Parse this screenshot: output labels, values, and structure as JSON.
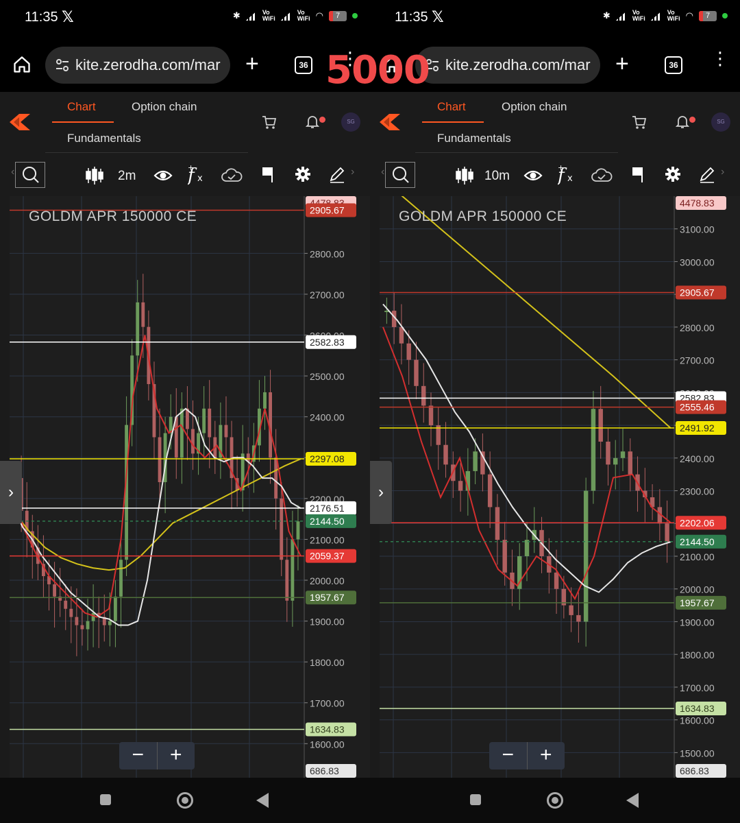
{
  "overlay_text": "5000",
  "screens": [
    {
      "status": {
        "time": "11:35",
        "vo_wifi": "Vo WiFi",
        "battery": "7"
      },
      "browser": {
        "url": "kite.zerodha.com/mar",
        "tab_count": "36"
      },
      "tabs": {
        "chart": "Chart",
        "option_chain": "Option chain",
        "fundamentals": "Fundamentals"
      },
      "avatar": "SG",
      "toolbar": {
        "interval": "2m"
      },
      "chart_data": {
        "type": "candlestick",
        "symbol": "GOLDM APR 150000 CE",
        "interval": "2m",
        "y_ticks": [
          "2800.00",
          "2700.00",
          "2600.00",
          "2500.00",
          "2400.00",
          "2300.00",
          "2200.00",
          "2100.00",
          "2000.00",
          "1900.00",
          "1800.00",
          "1700.00",
          "1600.00"
        ],
        "y_range": [
          1530,
          2940
        ],
        "price_labels": [
          {
            "value": "4478.83",
            "color": "#f8c8c8",
            "text_color": "#7a1f1f"
          },
          {
            "value": "2905.67",
            "color": "#c0392b",
            "text_color": "#ffffff"
          },
          {
            "value": "2582.83",
            "color": "#ffffff",
            "text_color": "#222222"
          },
          {
            "value": "2297.08",
            "color": "#f2e600",
            "text_color": "#222222"
          },
          {
            "value": "2176.51",
            "color": "#ffffff",
            "text_color": "#222222"
          },
          {
            "value": "2144.50",
            "color": "#2e7d4f",
            "text_color": "#ffffff"
          },
          {
            "value": "2059.37",
            "color": "#e53935",
            "text_color": "#ffffff"
          },
          {
            "value": "1957.67",
            "color": "#4f6f3a",
            "text_color": "#ffffff"
          },
          {
            "value": "1634.83",
            "color": "#c5e1a5",
            "text_color": "#33421f"
          },
          {
            "value": "686.83",
            "color": "#e6e6e6",
            "text_color": "#333333"
          }
        ],
        "closes": [
          2250,
          2170,
          2120,
          2080,
          2040,
          2010,
          1990,
          1960,
          1950,
          1930,
          1910,
          1890,
          1880,
          1900,
          1920,
          1910,
          1890,
          1900,
          1960,
          2050,
          2380,
          2550,
          2680,
          2620,
          2480,
          2350,
          2240,
          2360,
          2400,
          2300,
          2420,
          2370,
          2310,
          2360,
          2420,
          2350,
          2300,
          2380,
          2350,
          2250,
          2220,
          2310,
          2290,
          2330,
          2420,
          2460,
          2300,
          2200,
          2050,
          1950,
          2100,
          2144
        ],
        "ema_white": [
          2180,
          2130,
          2100,
          2060,
          2030,
          2000,
          1970,
          1950,
          1930,
          1910,
          1905,
          1890,
          1890,
          1900,
          2000,
          2150,
          2300,
          2400,
          2420,
          2400,
          2330,
          2300,
          2290,
          2300,
          2300,
          2280,
          2250,
          2250,
          2230,
          2190,
          2176
        ],
        "ema_yellow": [
          2170,
          2120,
          2080,
          2055,
          2040,
          2030,
          2025,
          2030,
          2060,
          2100,
          2140,
          2160,
          2180,
          2200,
          2220,
          2240,
          2260,
          2280,
          2297
        ],
        "ema_red": [
          2200,
          2120,
          2060,
          2010,
          1980,
          1950,
          1920,
          1910,
          1930,
          2100,
          2450,
          2600,
          2420,
          2360,
          2380,
          2330,
          2300,
          2330,
          2280,
          2220,
          2300,
          2420,
          2300,
          2120,
          2059
        ]
      }
    },
    {
      "status": {
        "time": "11:35",
        "vo_wifi": "Vo WiFi",
        "battery": "7"
      },
      "browser": {
        "url": "kite.zerodha.com/mar",
        "tab_count": "36"
      },
      "tabs": {
        "chart": "Chart",
        "option_chain": "Option chain",
        "fundamentals": "Fundamentals"
      },
      "avatar": "SG",
      "toolbar": {
        "interval": "10m"
      },
      "chart_data": {
        "type": "candlestick",
        "symbol": "GOLDM APR 150000 CE",
        "interval": "10m",
        "y_ticks": [
          "3100.00",
          "3000.00",
          "2900.00",
          "2800.00",
          "2700.00",
          "2600.00",
          "2500.00",
          "2400.00",
          "2300.00",
          "2200.00",
          "2100.00",
          "2000.00",
          "1900.00",
          "1800.00",
          "1700.00",
          "1600.00",
          "1500.00"
        ],
        "y_range": [
          1440,
          3200
        ],
        "price_labels": [
          {
            "value": "4478.83",
            "color": "#f8c8c8",
            "text_color": "#7a1f1f"
          },
          {
            "value": "2905.67",
            "color": "#c0392b",
            "text_color": "#ffffff"
          },
          {
            "value": "2582.83",
            "color": "#ffffff",
            "text_color": "#222222"
          },
          {
            "value": "2555.46",
            "color": "#c0392b",
            "text_color": "#ffffff"
          },
          {
            "value": "2491.92",
            "color": "#f2e600",
            "text_color": "#222222"
          },
          {
            "value": "2202.06",
            "color": "#e53935",
            "text_color": "#ffffff"
          },
          {
            "value": "2144.50",
            "color": "#2e7d4f",
            "text_color": "#ffffff"
          },
          {
            "value": "1957.67",
            "color": "#4f6f3a",
            "text_color": "#ffffff"
          },
          {
            "value": "1634.83",
            "color": "#c5e1a5",
            "text_color": "#33421f"
          },
          {
            "value": "686.83",
            "color": "#e6e6e6",
            "text_color": "#333333"
          }
        ],
        "closes": [
          2850,
          2800,
          2750,
          2700,
          2620,
          2560,
          2500,
          2440,
          2380,
          2330,
          2300,
          2360,
          2420,
          2350,
          2250,
          2150,
          2050,
          2000,
          2100,
          2150,
          2180,
          2100,
          2050,
          2000,
          1950,
          1920,
          1900,
          2300,
          2550,
          2450,
          2380,
          2400,
          2420,
          2350,
          2300,
          2280,
          2250,
          2200,
          2144
        ],
        "ema_white": [
          2870,
          2820,
          2760,
          2700,
          2620,
          2540,
          2480,
          2400,
          2320,
          2250,
          2190,
          2140,
          2090,
          2050,
          2010,
          1990,
          2030,
          2080,
          2110,
          2130,
          2144
        ],
        "ema_yellow": [
          3250,
          3100,
          2950,
          2800,
          2650,
          2491
        ],
        "ema_red": [
          2800,
          2650,
          2450,
          2280,
          2400,
          2180,
          2060,
          2010,
          2100,
          2060,
          1970,
          2100,
          2340,
          2350,
          2250,
          2202
        ]
      }
    }
  ]
}
